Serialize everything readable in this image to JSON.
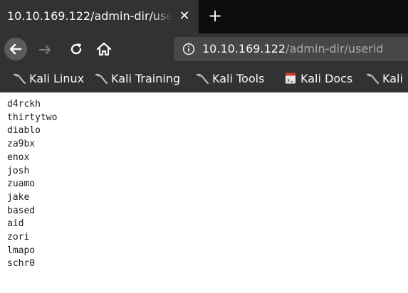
{
  "tab": {
    "title": "10.10.169.122/admin-dir/userid",
    "close_glyph": "✕"
  },
  "new_tab": {
    "glyph": "+"
  },
  "nav": {
    "back_icon": "arrow-left-icon",
    "forward_icon": "arrow-right-icon",
    "reload_icon": "reload-icon",
    "home_icon": "home-icon"
  },
  "urlbar": {
    "info_icon": "info-icon",
    "host": "10.10.169.122",
    "path": "/admin-dir/userid"
  },
  "bookmarks": [
    {
      "label": "Kali Linux",
      "icon": "kali-dragon-icon"
    },
    {
      "label": "Kali Training",
      "icon": "kali-dragon-icon"
    },
    {
      "label": "Kali Tools",
      "icon": "kali-dragon-icon"
    },
    {
      "label": "Kali Docs",
      "icon": "kali-docs-icon"
    },
    {
      "label": "Kali",
      "icon": "kali-dragon-icon"
    }
  ],
  "content": {
    "lines": [
      "d4rckh",
      "thirtytwo",
      "diablo",
      "za9bx",
      "enox",
      "josh",
      "zuamo",
      "jake",
      "based",
      "aid",
      "zori",
      "lmapo",
      "schr0"
    ]
  },
  "colors": {
    "tab_bg": "#323234",
    "tabstrip_bg": "#0c0c0d",
    "urlbar_bg": "#474749",
    "text_light": "#f9f9fa",
    "url_path": "#a8a8ad"
  }
}
